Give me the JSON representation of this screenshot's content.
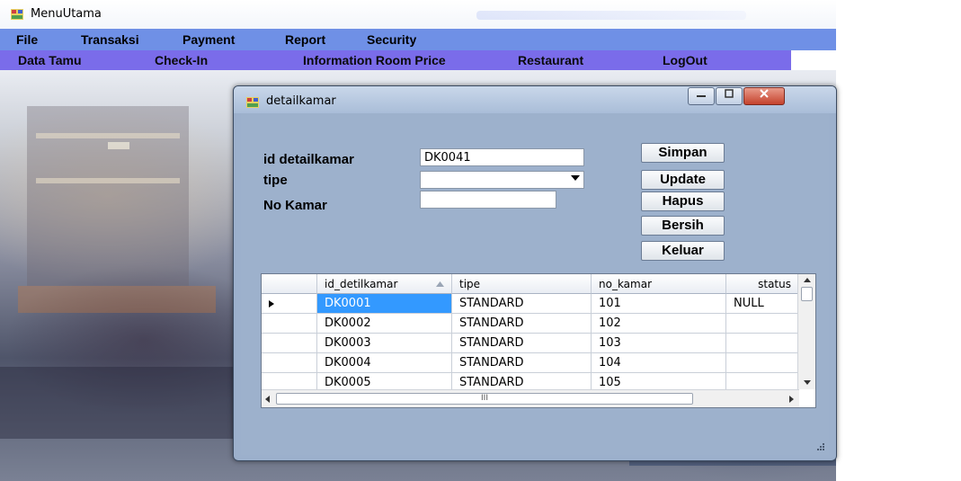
{
  "main_window": {
    "title": "MenuUtama",
    "menubar": [
      "File",
      "Transaksi",
      "Payment",
      "Report",
      "Security"
    ],
    "toolbar": [
      "Data Tamu",
      "Check-In",
      "Information Room Price",
      "Restaurant",
      "LogOut"
    ]
  },
  "dialog": {
    "title": "detailkamar",
    "form": {
      "id_label": "id detailkamar",
      "id_value": "DK0041",
      "tipe_label": "tipe",
      "tipe_value": "",
      "nokamar_label": "No Kamar",
      "nokamar_value": ""
    },
    "buttons": [
      "Simpan",
      "Update",
      "Hapus",
      "Bersih",
      "Keluar"
    ],
    "grid": {
      "columns": [
        "id_detilkamar",
        "tipe",
        "no_kamar",
        "status"
      ],
      "rows": [
        [
          "DK0001",
          "STANDARD",
          "101",
          "NULL"
        ],
        [
          "DK0002",
          "STANDARD",
          "102",
          ""
        ],
        [
          "DK0003",
          "STANDARD",
          "103",
          ""
        ],
        [
          "DK0004",
          "STANDARD",
          "104",
          ""
        ],
        [
          "DK0005",
          "STANDARD",
          "105",
          ""
        ]
      ],
      "selected_row": 0,
      "hscroll_thumb": "III"
    }
  },
  "colors": {
    "menubar": "#6f90e6",
    "toolbar": "#7a6cea",
    "dialog_bg": "#9db1cc",
    "selection": "#3399ff"
  }
}
